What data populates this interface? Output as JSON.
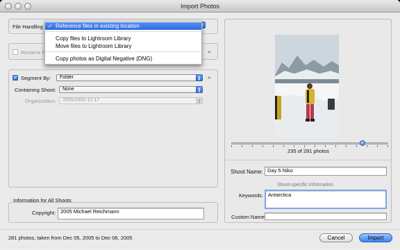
{
  "window": {
    "title": "Import Photos"
  },
  "file_handling": {
    "label": "File Handling",
    "menu": {
      "items": [
        {
          "label": "Reference files in existing location",
          "checked": true
        },
        {
          "label": "Copy files to Lightroom Library"
        },
        {
          "label": "Move files to Lightroom Library"
        },
        {
          "label": "Copy photos as Digital Negative (DNG)"
        }
      ],
      "check_mark": "✓"
    }
  },
  "rename": {
    "label": "Rename F"
  },
  "segment": {
    "label": "Segment By:",
    "value": "Folder",
    "containing_shoot_label": "Containing Shoot:",
    "containing_shoot_value": "None",
    "organization_label": "Organization:",
    "organization_value": "2005/2005-12-17"
  },
  "all_shoots": {
    "heading": "Information for All Shoots",
    "copyright_label": "Copyright:",
    "copyright_value": "2005 Michael Reichmann"
  },
  "preview": {
    "counter": "235 of 281 photos",
    "current": 235,
    "total": 281
  },
  "shoot": {
    "name_label": "Shoot Name:",
    "name_value": "Day 5 Niko",
    "specific_heading": "Shoot-specific Information",
    "keywords_label": "Keywords:",
    "keywords_value": "Antarctica",
    "custom_name_label": "Custom Name:",
    "custom_name_value": ""
  },
  "status": {
    "text": "281 photos, taken from Dec 05, 2005 to Dec 06, 2005"
  },
  "buttons": {
    "cancel": "Cancel",
    "import": "Import"
  },
  "icons": {
    "chevron": "»",
    "up_down_arrows": "▲▼"
  },
  "colors": {
    "accent": "#2f6ce0",
    "primary_button": "#3b82f0"
  }
}
